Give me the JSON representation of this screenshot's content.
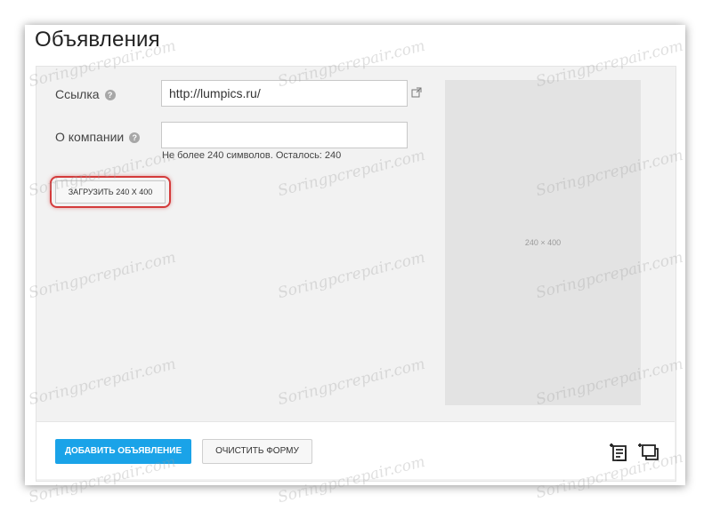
{
  "page": {
    "title": "Объявления"
  },
  "form": {
    "link_label": "Ссылка",
    "link_value": "http://lumpics.ru/",
    "about_label": "О компании",
    "about_value": "",
    "about_hint": "Не более 240 символов. Осталось: 240",
    "help_glyph": "?",
    "upload_button": "ЗАГРУЗИТЬ 240 X 400"
  },
  "preview": {
    "size_label": "240 × 400"
  },
  "footer": {
    "add_button": "ДОБАВИТЬ ОБЪЯВЛЕНИЕ",
    "clear_button": "ОЧИСТИТЬ ФОРМУ"
  },
  "colors": {
    "primary_button": "#1aa3e8",
    "highlight": "#d43b3b",
    "panel_bg": "#f2f2f2"
  },
  "icons": [
    "external-link-icon",
    "help-icon",
    "add-text-ad-icon",
    "add-image-ad-icon"
  ],
  "watermark": "Soringpcrepair.com"
}
